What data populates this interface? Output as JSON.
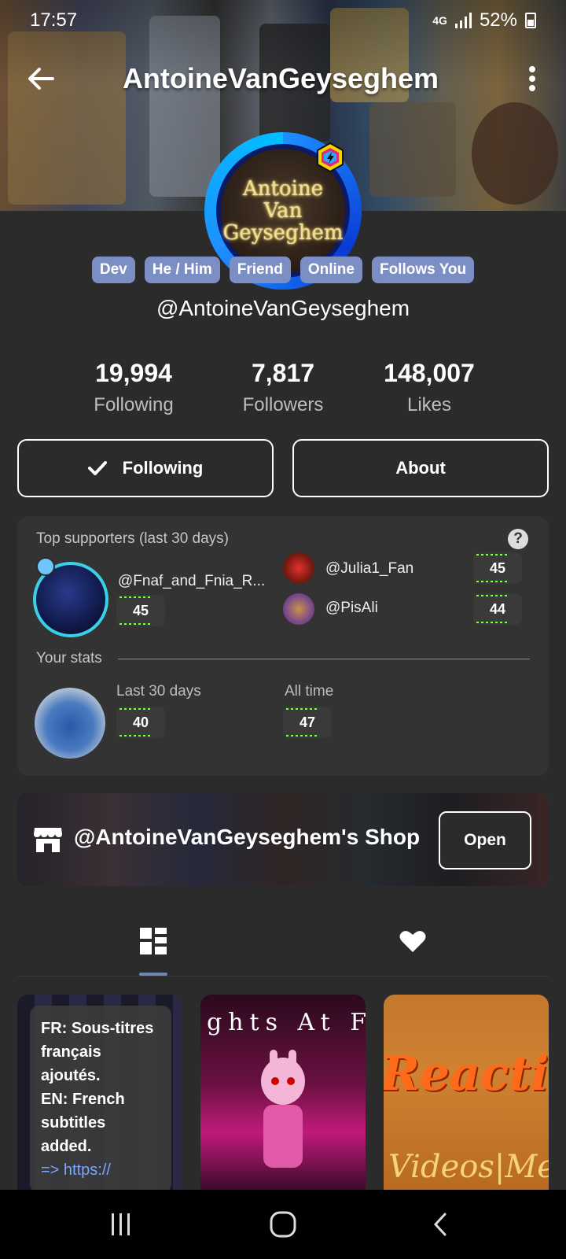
{
  "status_bar": {
    "time": "17:57",
    "network": "4G",
    "battery": "52%"
  },
  "header": {
    "title": "AntoineVanGeyseghem"
  },
  "avatar": {
    "line1": "Antoine",
    "line2": "Van",
    "line3": "Geyseghem"
  },
  "tags": [
    "Dev",
    "He / Him",
    "Friend",
    "Online",
    "Follows You"
  ],
  "handle": "@AntoineVanGeyseghem",
  "stats": {
    "following_count": "19,994",
    "following_label": "Following",
    "followers_count": "7,817",
    "followers_label": "Followers",
    "likes_count": "148,007",
    "likes_label": "Likes"
  },
  "actions": {
    "following_label": "Following",
    "about_label": "About"
  },
  "supporters": {
    "title": "Top supporters (last 30 days)",
    "help": "?",
    "top": {
      "name": "@Fnaf_and_Fnia_R...",
      "points": "45"
    },
    "others": [
      {
        "name": "@Julia1_Fan",
        "points": "45"
      },
      {
        "name": "@PisAli",
        "points": "44"
      }
    ],
    "your_stats_label": "Your stats",
    "last30_label": "Last 30 days",
    "last30_points": "40",
    "alltime_label": "All time",
    "alltime_points": "47"
  },
  "shop": {
    "title": "@AntoineVanGeyseghem's Shop",
    "open_label": "Open"
  },
  "tiles": {
    "t1_lines": [
      "FR: Sous-titres",
      "français",
      "ajoutés.",
      "EN: French",
      "subtitles",
      "added."
    ],
    "t1_link_prefix": "=> ",
    "t1_link": "https://",
    "t2_text": "ghts At F",
    "t3_text": "Reacti",
    "t3_sub": "Videos|Me"
  },
  "colors": {
    "background": "#2b2b2b",
    "tag": "#7b8fc4",
    "accent_ring": "#1e90ff",
    "points_spark": "#7cff4a"
  }
}
